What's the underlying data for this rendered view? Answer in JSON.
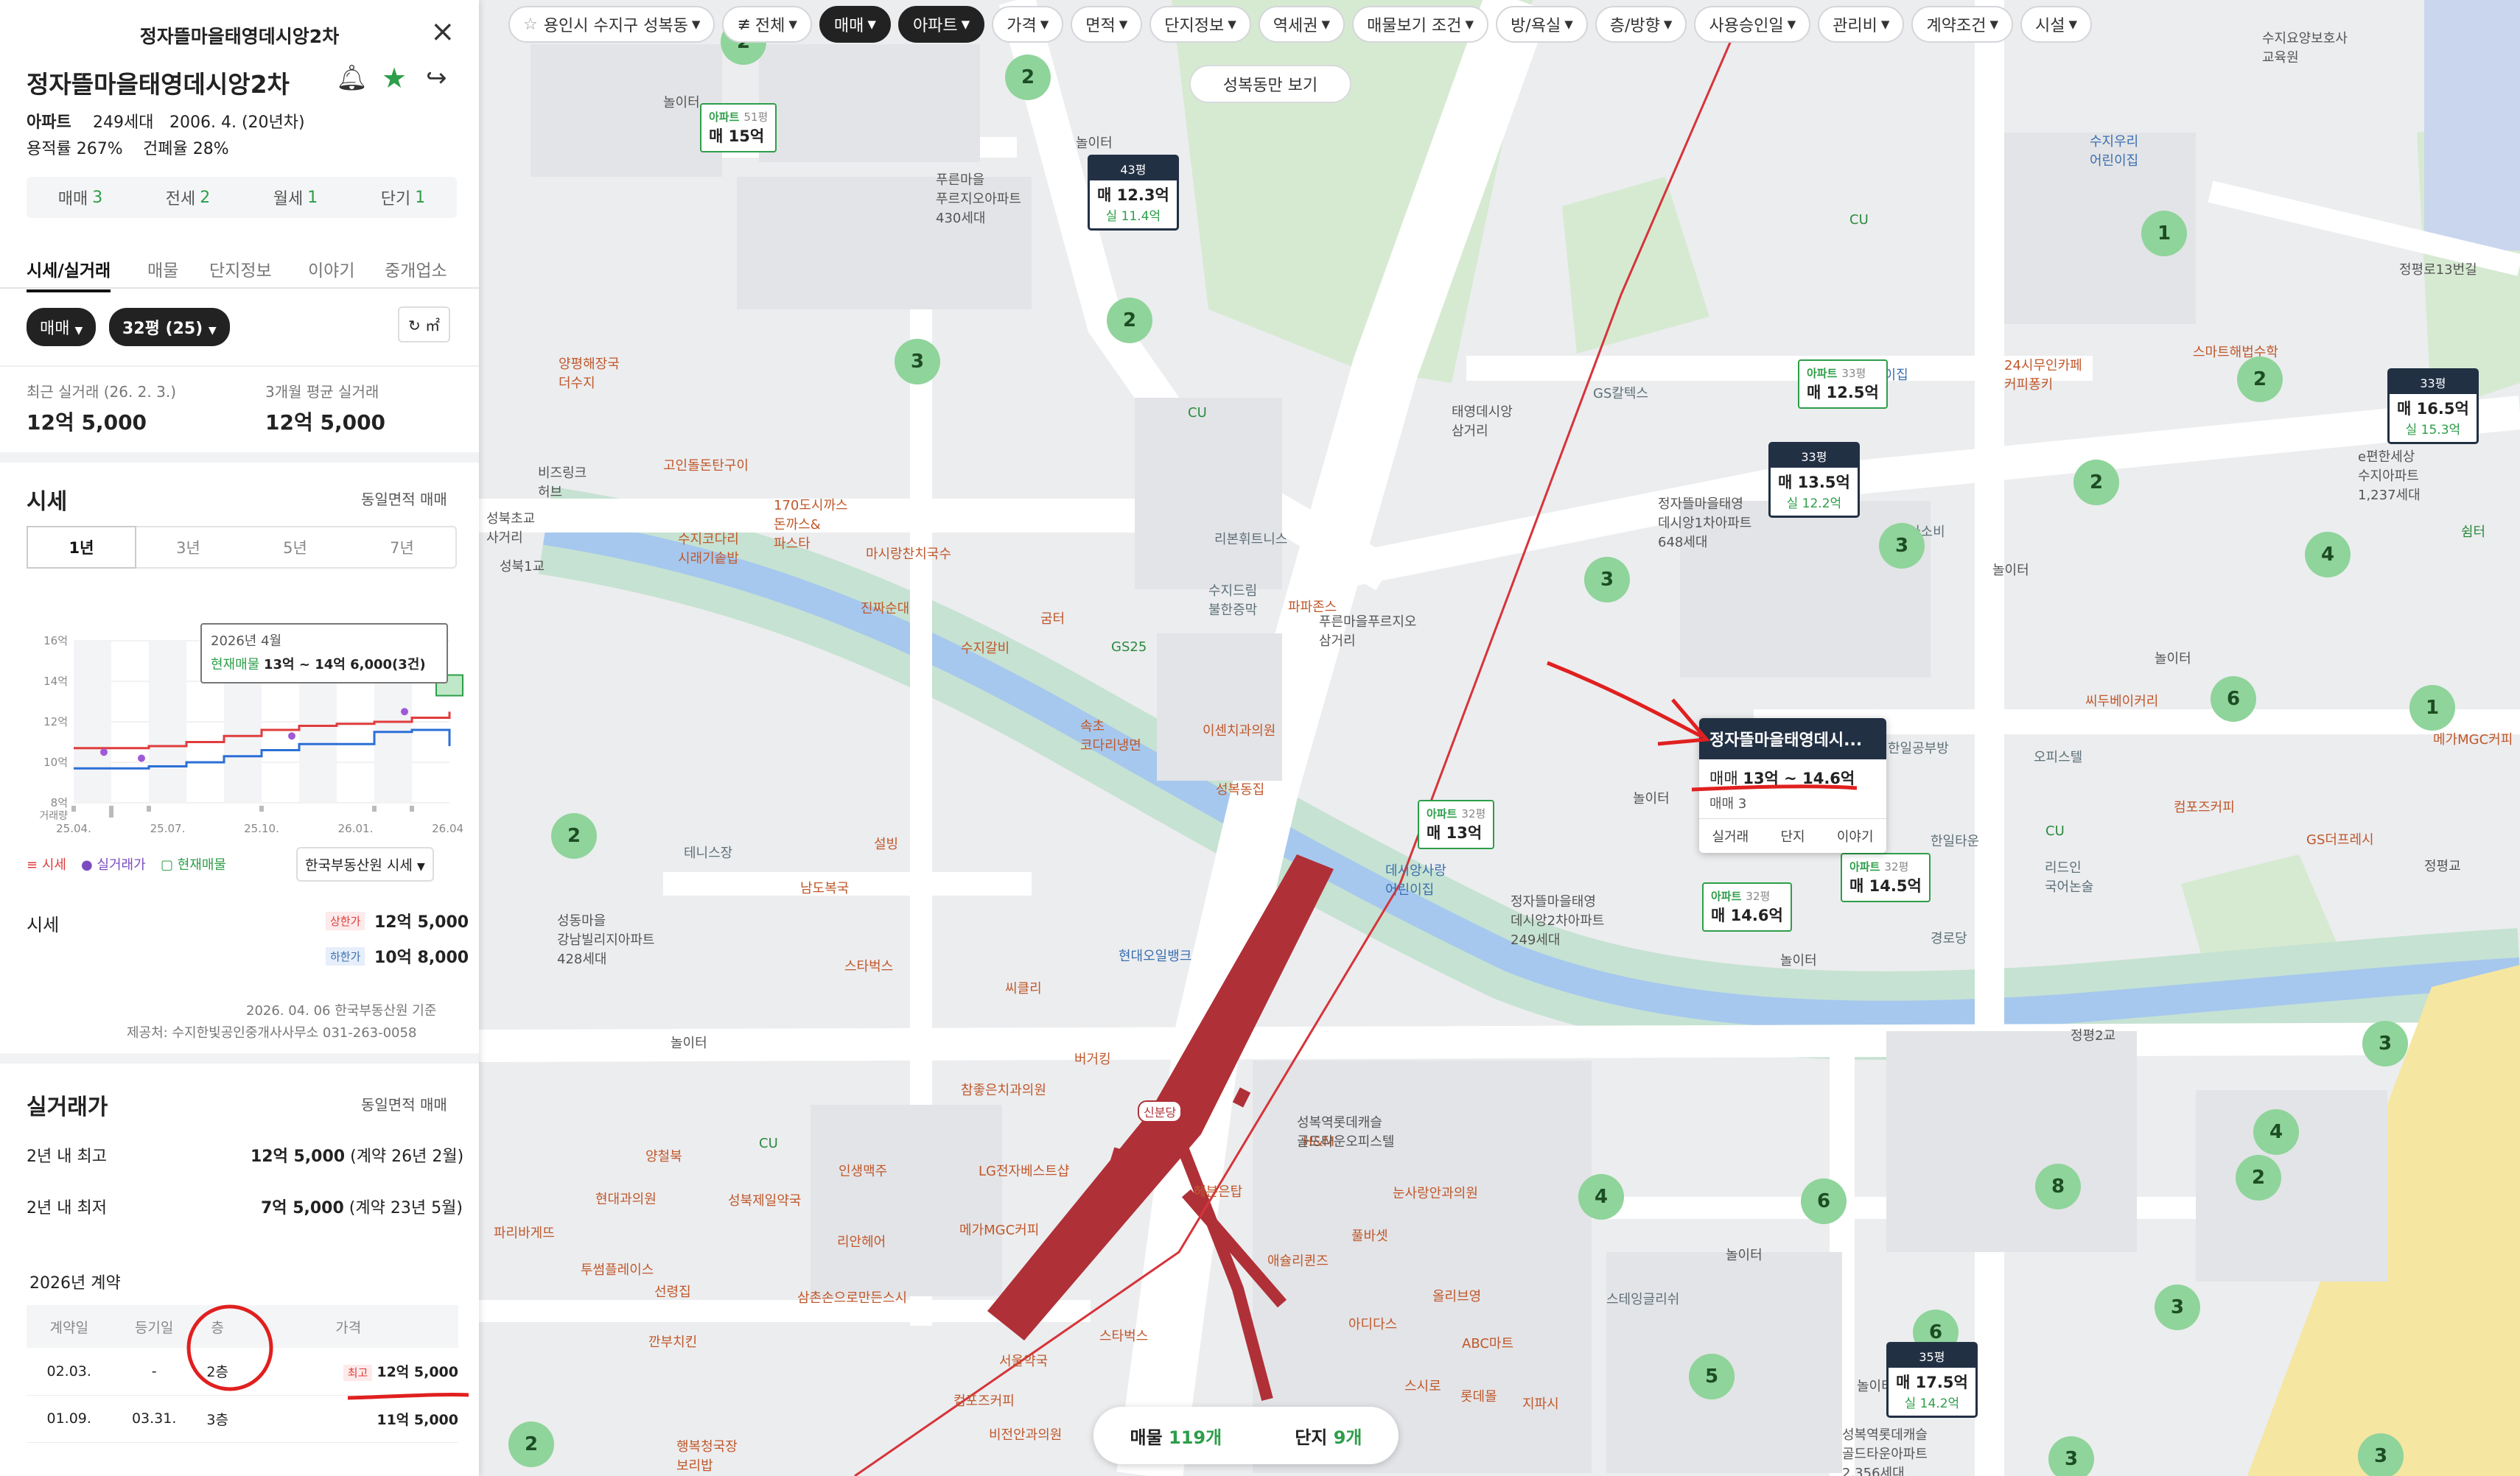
{
  "panel": {
    "header_title": "정자뜰마을태영데시앙2차",
    "name": "정자뜰마을태영데시앙2차",
    "type": "아파트",
    "households": "249세대",
    "built": "2006. 4. (20년차)",
    "far": "용적률 267%",
    "bcr": "건폐율 28%",
    "counts": [
      {
        "label": "매매",
        "value": "3"
      },
      {
        "label": "전세",
        "value": "2"
      },
      {
        "label": "월세",
        "value": "1"
      },
      {
        "label": "단기",
        "value": "1"
      }
    ],
    "tabs": [
      "시세/실거래",
      "매물",
      "단지정보",
      "이야기",
      "중개업소"
    ],
    "filter_trade": "매매",
    "filter_size": "32평 (25)",
    "unit_toggle": "㎡",
    "recent_label": "최근 실거래 (26. 2. 3.)",
    "recent_value": "12억 5,000",
    "avg_label": "3개월 평균 실거래",
    "avg_value": "12억 5,000",
    "price_section": "시세",
    "price_section_right": "동일면적 매매",
    "periods": [
      "1년",
      "3년",
      "5년",
      "7년"
    ],
    "tooltip_date": "2026년 4월",
    "tooltip_label": "현재매물",
    "tooltip_value": "13억 ~ 14억 6,000(3건)",
    "legend": [
      "시세",
      "실거래가",
      "현재매물"
    ],
    "source_select": "한국부동산원 시세",
    "quote_label": "시세",
    "upper_label": "상한가",
    "upper_value": "12억 5,000",
    "lower_label": "하한가",
    "lower_value": "10억 8,000",
    "basis_date": "2026. 04. 06 한국부동산원 기준",
    "provider": "제공처: 수지한빛공인중개사사무소 031-263-0058",
    "trade_section": "실거래가",
    "trade_section_right": "동일면적 매매",
    "max_label": "2년 내 최고",
    "max_value": "12억 5,000",
    "max_note": "(계약 26년 2월)",
    "min_label": "2년 내 최저",
    "min_value": "7억 5,000",
    "min_note": "(계약 23년 5월)",
    "year_label": "2026년 계약",
    "table_headers": [
      "계약일",
      "등기일",
      "층",
      "가격"
    ],
    "table_rows": [
      {
        "contract": "02.03.",
        "registry": "-",
        "floor": "2층",
        "badge": "최고",
        "price": "12억 5,000"
      },
      {
        "contract": "01.09.",
        "registry": "03.31.",
        "floor": "3층",
        "badge": "",
        "price": "11억 5,000"
      }
    ]
  },
  "chart_data": {
    "type": "line",
    "x": [
      "25.04.",
      "25.07.",
      "25.10.",
      "26.01.",
      "26.04."
    ],
    "ylabel": "거래량",
    "yticks": [
      "8억",
      "10억",
      "12억",
      "14억",
      "16억"
    ],
    "ylim": [
      8,
      16
    ],
    "series": [
      {
        "name": "시세",
        "color": "#e03c3c",
        "values": [
          10.7,
          10.7,
          10.8,
          11.0,
          11.3,
          11.6,
          11.8,
          11.9,
          12.0,
          12.2,
          12.5
        ]
      },
      {
        "name": "실거래가",
        "color": "#a05ad6",
        "values": [
          null,
          10.5,
          10.2,
          null,
          null,
          null,
          11.3,
          null,
          null,
          12.5,
          null
        ]
      },
      {
        "name": "현재매물",
        "color": "#2d9e49",
        "values": [
          null,
          null,
          null,
          null,
          null,
          null,
          null,
          null,
          null,
          null,
          13.8
        ]
      }
    ],
    "lower_series": {
      "color": "#2b6fd6",
      "values": [
        9.7,
        9.7,
        9.8,
        10.0,
        10.3,
        10.6,
        10.9,
        10.9,
        11.5,
        11.6,
        10.8
      ]
    }
  },
  "filters": [
    "용인시 수지구 성복동",
    "전체",
    "매매",
    "아파트",
    "가격",
    "면적",
    "단지정보",
    "역세권",
    "매물보기 조건",
    "방/욕실",
    "층/방향",
    "사용승인일",
    "관리비",
    "계약조건",
    "시설"
  ],
  "map_button": "성복동만 보기",
  "popup": {
    "title": "정자뜰마을태영데시...",
    "trade_label": "매매",
    "trade_value": "13억 ~ 14.6억",
    "count": "매매 3",
    "tabs": [
      "실거래",
      "단지",
      "이야기"
    ]
  },
  "bottom": {
    "listings_label": "매물",
    "listings_value": "119개",
    "complex_label": "단지",
    "complex_value": "9개"
  },
  "markers": [
    {
      "type": "아파트",
      "size": "51평",
      "price": "매 15억",
      "sub": ""
    },
    {
      "type": "아파트",
      "size": "33평",
      "price": "매 12.5억",
      "sub": ""
    },
    {
      "type": "아파트",
      "size": "32평",
      "price": "매 13억",
      "sub": ""
    },
    {
      "type": "아파트",
      "size": "32평",
      "price": "매 14.6억",
      "sub": ""
    },
    {
      "type": "아파트",
      "size": "32평",
      "price": "매 14.5억",
      "sub": ""
    }
  ],
  "dark_markers": [
    {
      "size": "43평",
      "price": "매 12.3억",
      "sub": "실 11.4억"
    },
    {
      "size": "33평",
      "price": "매 13.5억",
      "sub": "실 12.2억"
    },
    {
      "size": "33평",
      "price": "매 16.5억",
      "sub": "실 15.3억"
    },
    {
      "size": "35평",
      "price": "매 17.5억",
      "sub": "실 14.2억"
    }
  ],
  "clusters": [
    "2",
    "2",
    "2",
    "3",
    "2",
    "3",
    "1",
    "2",
    "4",
    "3",
    "3",
    "2",
    "6",
    "1",
    "2",
    "5",
    "3",
    "4",
    "8",
    "4",
    "6",
    "5",
    "6",
    "3",
    "3",
    "2",
    "2",
    "3"
  ],
  "places": [
    "푸른마을 푸르지오아파트 430세대",
    "정자뜰마을태영 데시앙1차아파트 648세대",
    "정자뜰마을태영 데시앙2차아파트 249세대",
    "태영데시앙 삼거리",
    "푸른마을푸르지오 삼거리",
    "성북초교 사거리",
    "성북1교",
    "성복역",
    "신분당",
    "성복역롯데캐슬 골드타운오피스텔",
    "성복역롯데캐슬 골드타운아파트 2,356세대",
    "e편한세상 수지아파트 1,237세대",
    "수지요양보호사 교육원",
    "수지우리 어린이집",
    "스마트해법수학",
    "GS칼텍스",
    "24시무인카페 커피퐁키",
    "아소비",
    "씨두베이커리",
    "한일공부방",
    "한일타운",
    "오피스텔",
    "컴포즈커피",
    "GS더프레시",
    "리드인 국어논술",
    "메가MGC커피",
    "경로당",
    "데시앙사랑 어린이집",
    "현대오일뱅크",
    "테니스장",
    "성동마을 강남빌리지아파트 428세대",
    "남도복국",
    "스타벅스",
    "설빙",
    "씨유",
    "씨클리",
    "버거킹",
    "참좋은치과의원",
    "LG전자베스트샵",
    "인생맥주",
    "리안헤어",
    "삼촌손으로만든스시",
    "현대과의원",
    "양철북",
    "파리바게뜨",
    "투썸플레이스",
    "선령집",
    "깐부치킨",
    "행복청국장 보리밥",
    "메가MGC커피",
    "성북제일약국",
    "헤븐은탑",
    "애슐리퀸즈",
    "올리브영",
    "ABC마트",
    "H&M",
    "눈사랑안과의원",
    "풀바셋",
    "아디다스",
    "스시로",
    "롯데몰",
    "지파시",
    "서울약국",
    "컴포즈커피",
    "비전안과의원",
    "스타벅스",
    "양평해장국 더수지",
    "고인돌돈탄구이",
    "170도시까스 돈까스&파스타",
    "수지코다리 시래기솥밥",
    "마시랑찬치국수",
    "진짜순대",
    "수지갈비",
    "굼터",
    "GS25",
    "속초 코다리냉면",
    "이센치과의원",
    "성복동집",
    "리본휘트니스",
    "수지드림 불한증막",
    "파파존스",
    "비즈링크 허브",
    "스테잉글리쉬",
    "CU",
    "정평2교",
    "정평교",
    "성복동만 보기",
    "정평로13번길"
  ]
}
